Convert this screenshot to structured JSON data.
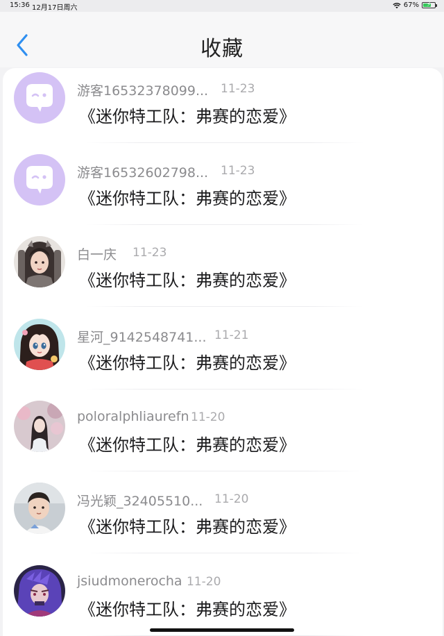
{
  "status_bar": {
    "time": "15:36",
    "date": "12月17日周六",
    "battery": "67%",
    "battery_level": 0.67
  },
  "header": {
    "title": "收藏"
  },
  "items": [
    {
      "name": "游客16532378099...",
      "date": "11-23",
      "title": "《迷你特工队：弗赛的恋爱》",
      "avatar": "default-chat-avatar"
    },
    {
      "name": "游客16532602798...",
      "date": "11-23",
      "title": "《迷你特工队：弗赛的恋爱》",
      "avatar": "default-chat-avatar"
    },
    {
      "name": "白一庆",
      "date": "11-23",
      "title": "《迷你特工队：弗赛的恋爱》",
      "avatar": "armored-girl-avatar"
    },
    {
      "name": "星河_9142548741...",
      "date": "11-21",
      "title": "《迷你特工队：弗赛的恋爱》",
      "avatar": "anime-girl-avatar"
    },
    {
      "name": "poloralphliaurefn",
      "date": "11-20",
      "title": "《迷你特工队：弗赛的恋爱》",
      "avatar": "girl-photo-avatar"
    },
    {
      "name": "冯光颖_32405510...",
      "date": "11-20",
      "title": "《迷你特工队：弗赛的恋爱》",
      "avatar": "child-photo-avatar"
    },
    {
      "name": "jsiudmonerocha",
      "date": "11-20",
      "title": "《迷你特工队：弗赛的恋爱》",
      "avatar": "purple-hair-avatar"
    }
  ],
  "colors": {
    "accent": "#2f8ff0",
    "default_avatar_bg": "#d4c2f5"
  }
}
